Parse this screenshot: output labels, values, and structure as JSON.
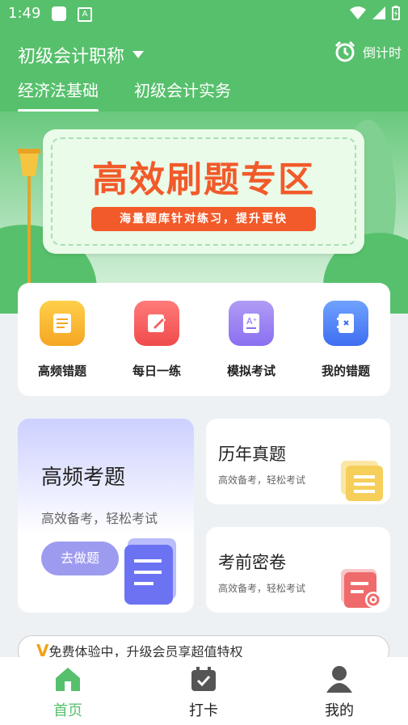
{
  "status": {
    "time": "1:49",
    "app_badge": "A"
  },
  "header": {
    "subject": "初级会计职称",
    "countdown": "倒计时",
    "tabs": [
      {
        "label": "经济法基础"
      },
      {
        "label": "初级会计实务"
      }
    ]
  },
  "banner": {
    "title": "高效刷题专区",
    "subtitle": "海量题库针对练习，提升更快"
  },
  "quick": [
    {
      "label": "高频错题",
      "color": "#f5a623"
    },
    {
      "label": "每日一练",
      "color": "#f06060"
    },
    {
      "label": "模拟考试",
      "color": "#9b7ff0"
    },
    {
      "label": "我的错题",
      "color": "#4f7ff0"
    }
  ],
  "cards": {
    "big": {
      "title": "高频考题",
      "subtitle": "高效备考，轻松考试",
      "button": "去做题"
    },
    "past": {
      "title": "历年真题",
      "subtitle": "高效备考，轻松考试"
    },
    "secret": {
      "title": "考前密卷",
      "subtitle": "高效备考，轻松考试"
    }
  },
  "vip": {
    "v": "V",
    "text": "免费体验中，升级会员享超值特权"
  },
  "tabbar": [
    {
      "label": "首页",
      "color": "#57c06c"
    },
    {
      "label": "打卡",
      "color": "#222222"
    },
    {
      "label": "我的",
      "color": "#222222"
    }
  ]
}
